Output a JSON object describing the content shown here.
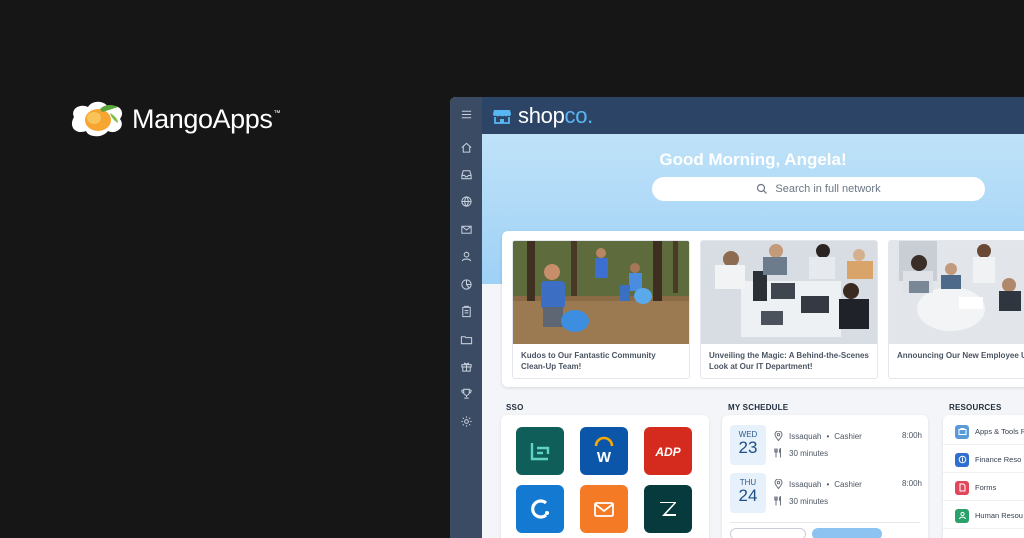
{
  "brand": {
    "name": "MangoApps",
    "tm": "™"
  },
  "app": {
    "logo_main": "shop",
    "logo_accent": "co.",
    "rail": [
      {
        "icon": "menu-icon"
      },
      {
        "icon": "home-icon"
      },
      {
        "icon": "inbox-icon"
      },
      {
        "icon": "globe-icon"
      },
      {
        "icon": "mail-icon"
      },
      {
        "icon": "person-icon"
      },
      {
        "icon": "chart-pie-icon"
      },
      {
        "icon": "clipboard-icon"
      },
      {
        "icon": "folder-icon"
      },
      {
        "icon": "gift-icon"
      },
      {
        "icon": "trophy-icon"
      },
      {
        "icon": "settings-icon"
      }
    ],
    "greeting": "Good Morning, Angela!",
    "search": {
      "placeholder": "Search in full network"
    },
    "news": [
      {
        "title": "Kudos to Our Fantastic Community Clean-Up Team!"
      },
      {
        "title": "Unveiling the Magic: A Behind-the-Scenes Look at Our IT Department!"
      },
      {
        "title": "Announcing Our New Employee Updates!"
      }
    ],
    "sso": {
      "label": "SSO",
      "apps": [
        {
          "icon": "linear-app-icon",
          "color": "#0f5e59"
        },
        {
          "icon": "workday-icon",
          "color": "#0b56a8"
        },
        {
          "icon": "adp-icon",
          "color": "#d52b1e"
        },
        {
          "icon": "coupa-icon",
          "color": "#1479d1"
        },
        {
          "icon": "mail-app-icon",
          "color": "#f47a25"
        },
        {
          "icon": "zendesk-icon",
          "color": "#063a3d"
        }
      ]
    },
    "schedule": {
      "label": "MY SCHEDULE",
      "items": [
        {
          "dow": "WED",
          "day": "23",
          "location": "Issaquah",
          "role": "Cashier",
          "duration": "30 minutes",
          "time": "8:00h"
        },
        {
          "dow": "THU",
          "day": "24",
          "location": "Issaquah",
          "role": "Cashier",
          "duration": "30 minutes",
          "time": "8:00h"
        }
      ],
      "separator": "•"
    },
    "resources": {
      "label": "RESOURCES",
      "items": [
        {
          "label": "Apps & Tools R",
          "color": "#5b9bd5"
        },
        {
          "label": "Finance Reso",
          "color": "#2f6fd0"
        },
        {
          "label": "Forms",
          "color": "#e0475a"
        },
        {
          "label": "Human Resou",
          "color": "#2aa06a"
        }
      ]
    }
  }
}
